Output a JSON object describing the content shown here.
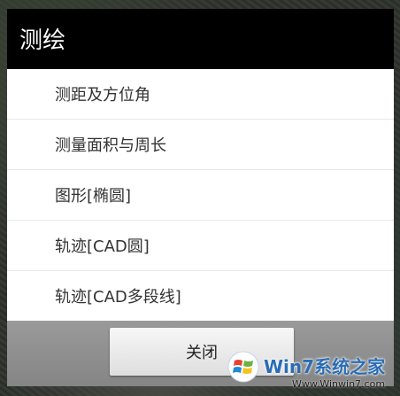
{
  "dialog": {
    "title": "测绘",
    "items": [
      {
        "label": "测距及方位角"
      },
      {
        "label": "测量面积与周长"
      },
      {
        "label": "图形[椭圆]"
      },
      {
        "label": "轨迹[CAD圆]"
      },
      {
        "label": "轨迹[CAD多段线]"
      }
    ],
    "close_label": "关闭"
  },
  "watermark": {
    "brand": "Win7系统之家",
    "url": "Www.Winwin7.com",
    "icon": "windows-logo-icon"
  },
  "colors": {
    "header_bg": "#000000",
    "list_bg": "#ffffff",
    "footer_bg": "#8f8f8f",
    "item_text": "#333333"
  }
}
